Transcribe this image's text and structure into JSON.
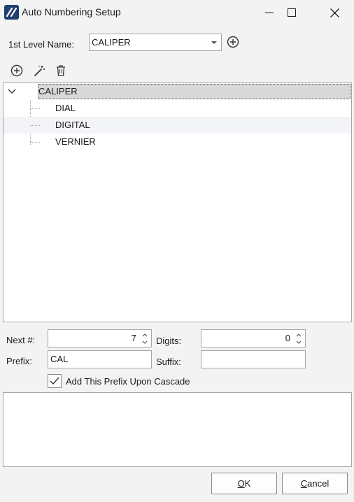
{
  "window": {
    "title": "Auto Numbering Setup",
    "controls": [
      "minimize-icon",
      "maximize-icon",
      "close-icon"
    ]
  },
  "level": {
    "label": "1st Level Name:",
    "selected": "CALIPER"
  },
  "toolbar": {
    "icons": [
      "add-circle-icon",
      "magic-wand-icon",
      "trash-icon"
    ]
  },
  "tree": {
    "root": "CALIPER",
    "children": [
      "DIAL",
      "DIGITAL",
      "VERNIER"
    ]
  },
  "fields": {
    "next_label": "Next #:",
    "next_value": "7",
    "digits_label": "Digits:",
    "digits_value": "0",
    "prefix_label": "Prefix:",
    "prefix_value": "CAL",
    "suffix_label": "Suffix:",
    "suffix_value": ""
  },
  "cascade": {
    "label": "Add This Prefix Upon Cascade",
    "checked": true
  },
  "buttons": {
    "ok_mnemonic": "O",
    "ok_rest": "K",
    "cancel_mnemonic": "C",
    "cancel_rest": "ancel"
  },
  "colors": {
    "accent": "#1f3f6e",
    "selection": "#d9d9d9",
    "hover_row": "#f3f4f8"
  }
}
